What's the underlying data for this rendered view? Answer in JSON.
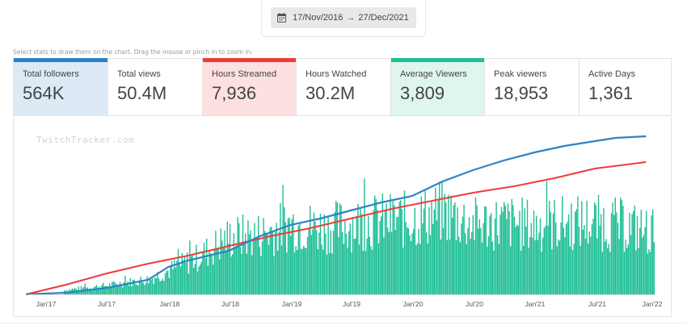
{
  "date_range": {
    "start": "17/Nov/2016",
    "arrow": "→",
    "end": "27/Dec/2021",
    "icon": "calendar-icon"
  },
  "hint": "Select stats to draw them on the chart. Drag the mouse or pinch in to zoom in.",
  "stats": [
    {
      "label": "Total followers",
      "value": "564K",
      "state": "blue",
      "color": "#2f82c4"
    },
    {
      "label": "Total views",
      "value": "50.4M",
      "state": "none"
    },
    {
      "label": "Hours Streamed",
      "value": "7,936",
      "state": "red",
      "color": "#ef3b3b"
    },
    {
      "label": "Hours Watched",
      "value": "30.2M",
      "state": "none"
    },
    {
      "label": "Average Viewers",
      "value": "3,809",
      "state": "green",
      "color": "#1fbf96"
    },
    {
      "label": "Peak viewers",
      "value": "18,953",
      "state": "none"
    },
    {
      "label": "Active Days",
      "value": "1,361",
      "state": "none"
    }
  ],
  "watermark": "TwitchTracker.com",
  "chart_data": {
    "type": "area",
    "x_ticks": [
      "Jan'17",
      "Jul'17",
      "Jan'18",
      "Jul'18",
      "Jan'19",
      "Jul'19",
      "Jan'20",
      "Jul'20",
      "Jan'21",
      "Jul'21",
      "Jan'22"
    ],
    "x_range": [
      "2016-11-17",
      "2021-12-27"
    ],
    "grid": false,
    "colors": {
      "followers": "#2f82c4",
      "hours_streamed": "#ef3b3b",
      "average_viewers": "#1fbf96"
    },
    "series": [
      {
        "name": "Total followers",
        "x": [
          "2016-11",
          "2017-03",
          "2017-07",
          "2017-11",
          "2018-01",
          "2018-03",
          "2018-07",
          "2018-10",
          "2019-01",
          "2019-04",
          "2019-07",
          "2019-10",
          "2020-01",
          "2020-04",
          "2020-07",
          "2020-10",
          "2021-01",
          "2021-04",
          "2021-07",
          "2021-09",
          "2021-12"
        ],
        "values": [
          0.0,
          0.01,
          0.04,
          0.09,
          0.17,
          0.21,
          0.27,
          0.36,
          0.43,
          0.47,
          0.52,
          0.57,
          0.61,
          0.7,
          0.77,
          0.83,
          0.88,
          0.92,
          0.95,
          0.97,
          0.98
        ]
      },
      {
        "name": "Hours Streamed",
        "x": [
          "2016-11",
          "2017-03",
          "2017-07",
          "2017-11",
          "2018-03",
          "2018-07",
          "2018-11",
          "2019-03",
          "2019-07",
          "2019-11",
          "2020-03",
          "2020-07",
          "2020-11",
          "2021-03",
          "2021-07",
          "2021-12"
        ],
        "values": [
          0.0,
          0.06,
          0.13,
          0.19,
          0.24,
          0.3,
          0.36,
          0.41,
          0.47,
          0.53,
          0.58,
          0.63,
          0.67,
          0.72,
          0.78,
          0.82
        ]
      },
      {
        "name": "Average Viewers",
        "x": [
          "2016-11",
          "2017-03",
          "2017-07",
          "2017-11",
          "2018-01",
          "2018-04",
          "2018-07",
          "2018-10",
          "2019-01",
          "2019-04",
          "2019-07",
          "2019-10",
          "2020-01",
          "2020-04",
          "2020-07",
          "2020-10",
          "2021-01",
          "2021-04",
          "2021-07",
          "2021-10",
          "2021-12"
        ],
        "values": [
          0.0,
          0.03,
          0.06,
          0.1,
          0.16,
          0.25,
          0.38,
          0.4,
          0.47,
          0.44,
          0.47,
          0.49,
          0.5,
          0.55,
          0.47,
          0.48,
          0.46,
          0.48,
          0.48,
          0.46,
          0.42
        ]
      }
    ]
  }
}
